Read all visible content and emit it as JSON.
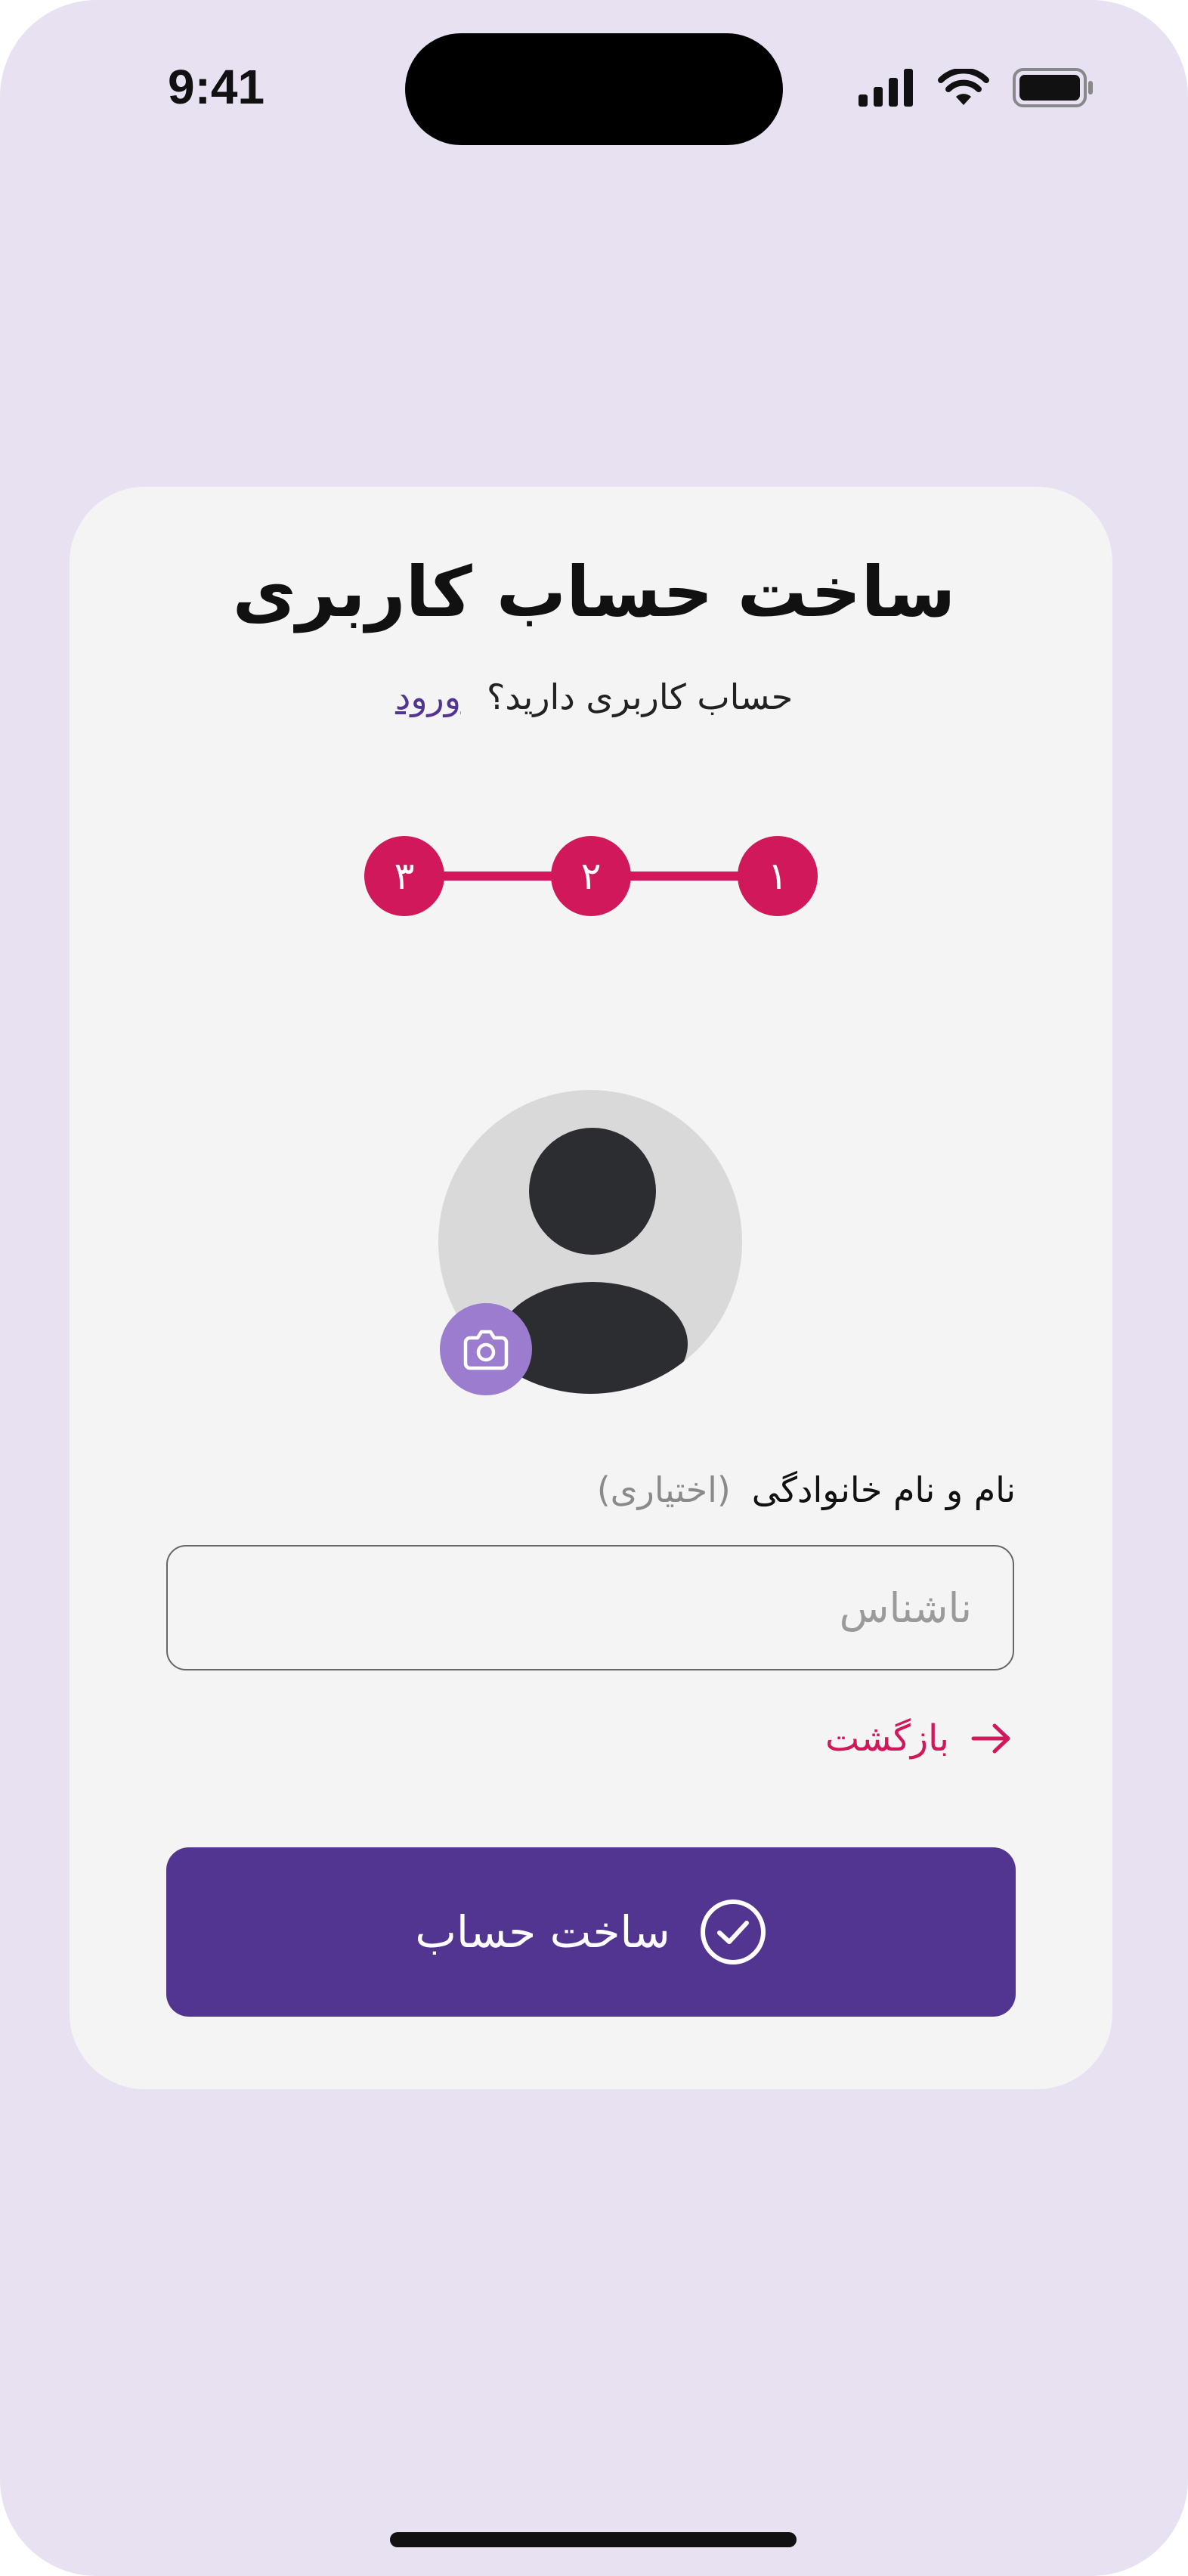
{
  "status_bar": {
    "time": "9:41"
  },
  "card": {
    "title": "ساخت حساب کاربری",
    "subtitle_question": "حساب کاربری دارید؟",
    "login_link": "ورود"
  },
  "stepper": {
    "steps": [
      "۱",
      "۲",
      "۳"
    ],
    "current_step": 3
  },
  "profile": {
    "camera_icon": "camera-icon",
    "avatar_icon": "user-silhouette-icon"
  },
  "form": {
    "name_label": "نام و نام خانوادگی",
    "name_optional": "(اختیاری)",
    "name_placeholder": "ناشناس",
    "name_value": ""
  },
  "actions": {
    "back_label": "بازگشت",
    "create_label": "ساخت حساب"
  },
  "colors": {
    "background": "#e8e1f1",
    "card": "#f4f4f4",
    "accent": "#d1185a",
    "primary": "#523590",
    "camera_button": "#9b7ccf"
  }
}
